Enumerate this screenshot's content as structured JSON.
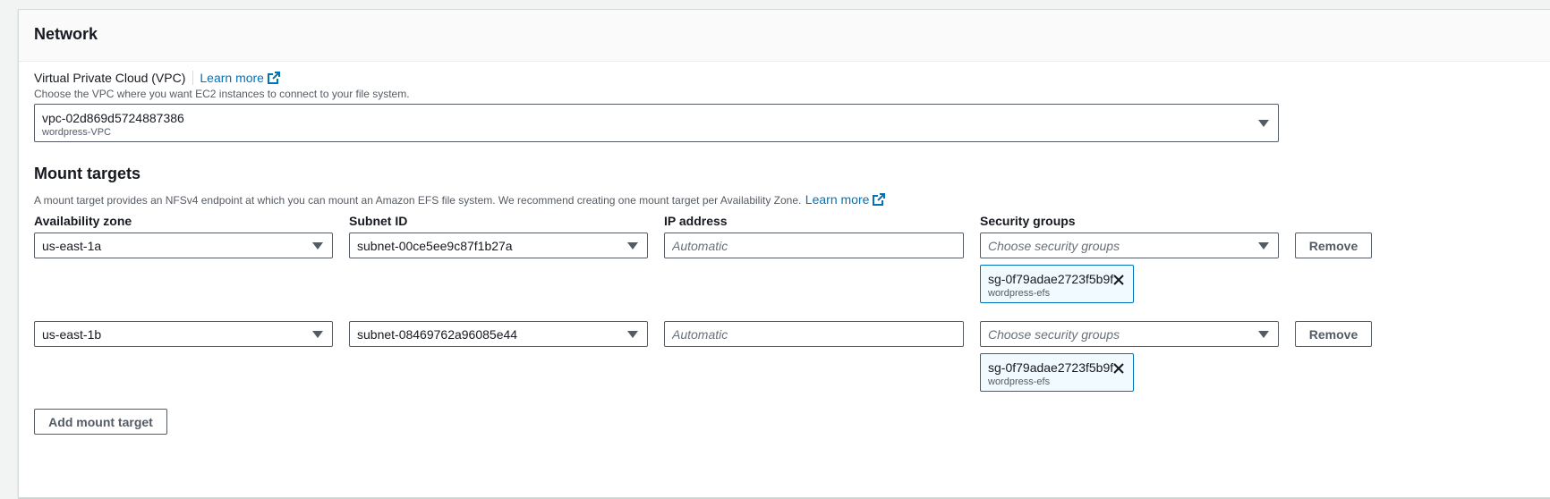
{
  "network": {
    "title": "Network",
    "vpc": {
      "label": "Virtual Private Cloud (VPC)",
      "learn_more": "Learn more",
      "description": "Choose the VPC where you want EC2 instances to connect to your file system.",
      "selected_id": "vpc-02d869d5724887386",
      "selected_name": "wordpress-VPC"
    }
  },
  "mount_targets": {
    "title": "Mount targets",
    "description": "A mount target provides an NFSv4 endpoint at which you can mount an Amazon EFS file system. We recommend creating one mount target per Availability Zone.",
    "learn_more": "Learn more",
    "columns": {
      "az": "Availability zone",
      "subnet": "Subnet ID",
      "ip": "IP address",
      "sg": "Security groups"
    },
    "rows": [
      {
        "az": "us-east-1a",
        "subnet": "subnet-00ce5ee9c87f1b27a",
        "ip_placeholder": "Automatic",
        "sg_placeholder": "Choose security groups",
        "remove_label": "Remove",
        "token_id": "sg-0f79adae2723f5b9f",
        "token_name": "wordpress-efs"
      },
      {
        "az": "us-east-1b",
        "subnet": "subnet-08469762a96085e44",
        "ip_placeholder": "Automatic",
        "sg_placeholder": "Choose security groups",
        "remove_label": "Remove",
        "token_id": "sg-0f79adae2723f5b9f",
        "token_name": "wordpress-efs"
      }
    ],
    "add_label": "Add mount target"
  },
  "icons": {
    "external": "external-link-icon",
    "caret": "caret-down-icon",
    "remove_token": "close-icon"
  },
  "colors": {
    "link": "#0073bb",
    "token_border": "#0073bb",
    "token_bg": "#f1faff"
  }
}
